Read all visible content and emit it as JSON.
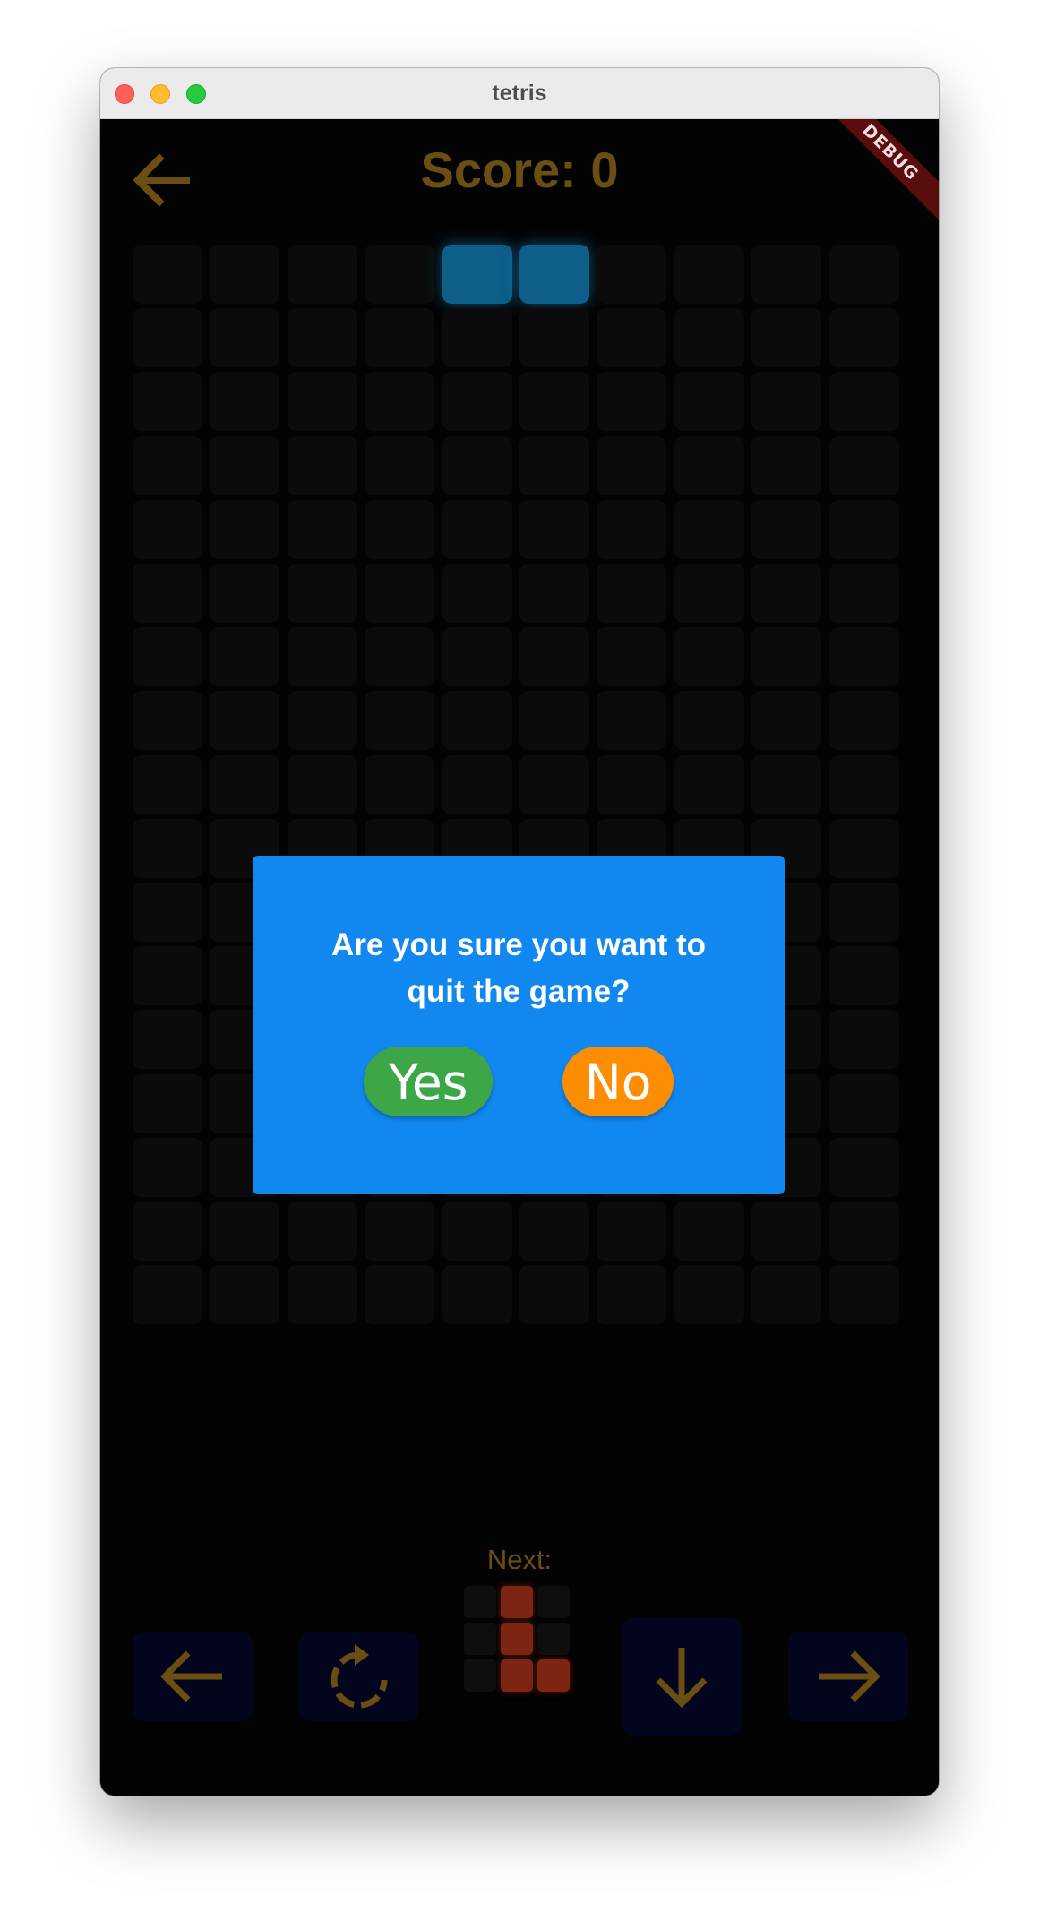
{
  "window": {
    "title": "tetris",
    "controls": [
      "close",
      "minimize",
      "zoom"
    ]
  },
  "header": {
    "back_icon": "arrow-left-icon",
    "score_text": "Score: 0",
    "debug_banner": "DEBUG"
  },
  "colors": {
    "accent": "#6b4e12",
    "active_piece": "#0d5e88",
    "dialog_bg": "#1188ef",
    "yes_bg": "#3da747",
    "no_bg": "#fd8e04",
    "next_piece": "#7d2412"
  },
  "board": {
    "columns": 10,
    "rows": 17,
    "active_cells": [
      [
        0,
        4
      ],
      [
        0,
        5
      ]
    ]
  },
  "next_preview": {
    "label": "Next:",
    "columns": 3,
    "rows": 3,
    "filled": [
      [
        0,
        1
      ],
      [
        1,
        1
      ],
      [
        2,
        1
      ],
      [
        2,
        2
      ]
    ]
  },
  "controls": {
    "left": "arrow-left-icon",
    "rotate": "rotate-icon",
    "down": "arrow-down-icon",
    "right": "arrow-right-icon"
  },
  "dialog": {
    "message_line1": "Are you sure you want to",
    "message_line2": "quit the game?",
    "yes_label": "Yes",
    "no_label": "No"
  }
}
